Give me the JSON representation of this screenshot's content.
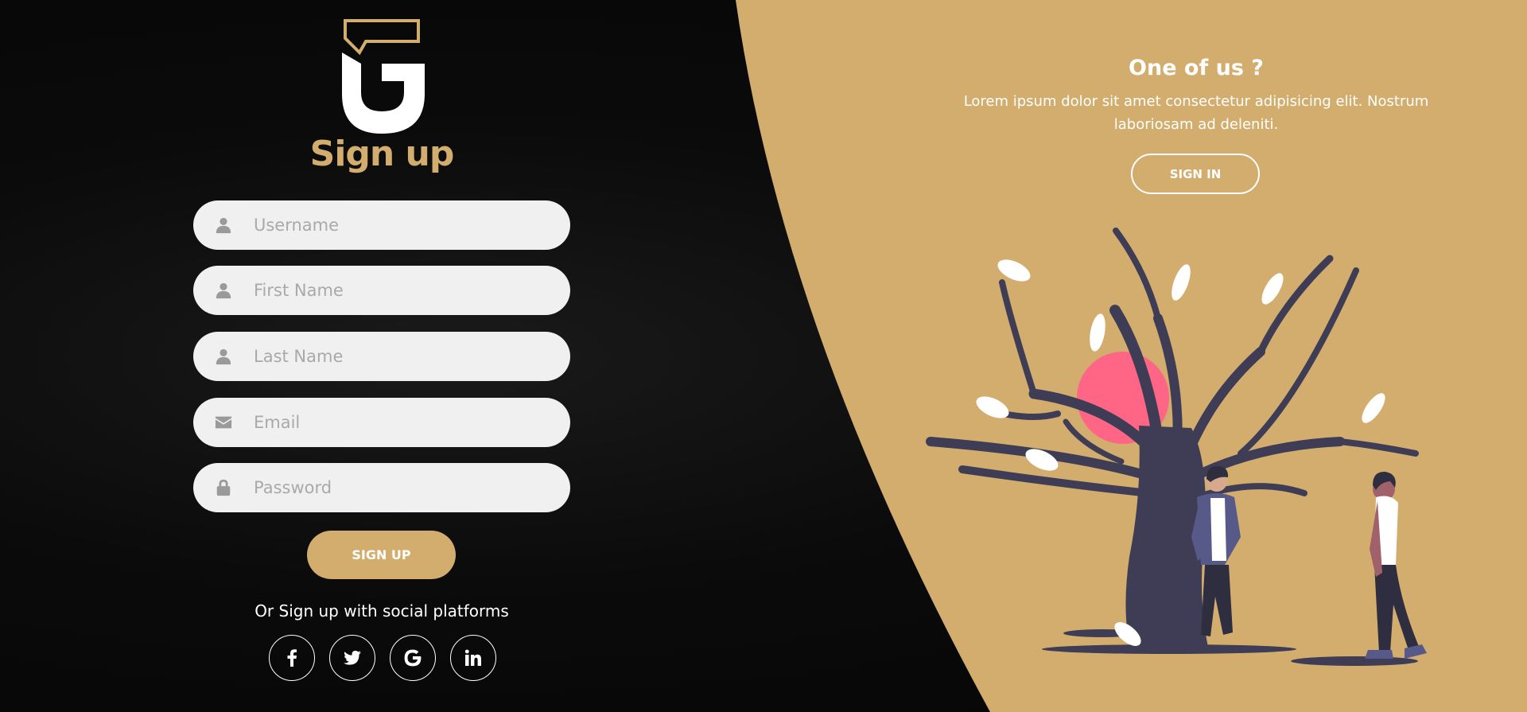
{
  "colors": {
    "accent": "#d2ad6e",
    "background": "#0a0a0a",
    "field_bg": "#f0f0f0",
    "tree": "#3f3d56",
    "sun": "#ff6584"
  },
  "logo": {
    "icon": "brand-logo-icon"
  },
  "form": {
    "title": "Sign up",
    "fields": [
      {
        "icon": "user-icon",
        "placeholder": "Username",
        "value": ""
      },
      {
        "icon": "user-icon",
        "placeholder": "First Name",
        "value": ""
      },
      {
        "icon": "user-icon",
        "placeholder": "Last Name",
        "value": ""
      },
      {
        "icon": "envelope-icon",
        "placeholder": "Email",
        "value": ""
      },
      {
        "icon": "lock-icon",
        "placeholder": "Password",
        "value": ""
      }
    ],
    "submit_label": "SIGN UP",
    "social_text": "Or Sign up with social platforms",
    "socials": [
      {
        "icon": "facebook-icon"
      },
      {
        "icon": "twitter-icon"
      },
      {
        "icon": "google-icon"
      },
      {
        "icon": "linkedin-icon"
      }
    ]
  },
  "panel": {
    "title": "One of us ?",
    "description": "Lorem ipsum dolor sit amet consectetur adipisicing elit. Nostrum laboriosam ad deleniti.",
    "button_label": "SIGN IN"
  }
}
